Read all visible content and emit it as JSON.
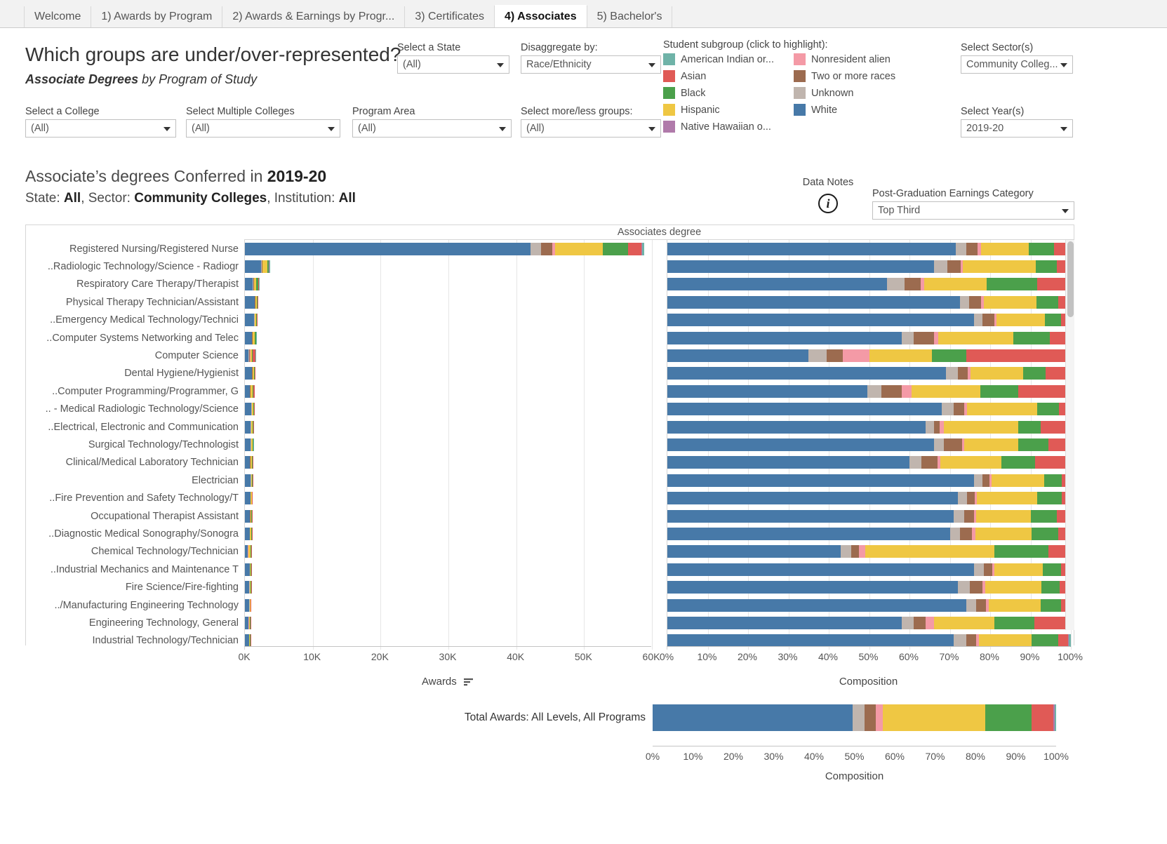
{
  "tabs": [
    {
      "label": "Welcome",
      "active": false
    },
    {
      "label": "1) Awards by Program",
      "active": false
    },
    {
      "label": "2) Awards & Earnings by Progr...",
      "active": false
    },
    {
      "label": "3) Certificates",
      "active": false
    },
    {
      "label": "4) Associates",
      "active": true
    },
    {
      "label": "5) Bachelor's",
      "active": false
    }
  ],
  "header": {
    "question": "Which groups are under/over-represented?",
    "subtitle_bold": "Associate Degrees",
    "subtitle_rest": " by Program of Study"
  },
  "controls": {
    "college": {
      "label": "Select a College",
      "value": "(All)"
    },
    "multi_colleges": {
      "label": "Select Multiple Colleges",
      "value": "(All)"
    },
    "program_area": {
      "label": "Program Area",
      "value": "(All)"
    },
    "state": {
      "label": "Select a State",
      "value": "(All)"
    },
    "disaggregate": {
      "label": "Disaggregate by:",
      "value": "Race/Ethnicity"
    },
    "more_less": {
      "label": "Select more/less groups:",
      "value": "(All)"
    },
    "sector": {
      "label": "Select Sector(s)",
      "value": "Community Colleg..."
    },
    "year": {
      "label": "Select Year(s)",
      "value": "2019-20"
    },
    "earnings": {
      "label": "Post-Graduation Earnings Category",
      "value": "Top Third"
    }
  },
  "legend": {
    "title": "Student subgroup (click to highlight):",
    "col1": [
      {
        "label": "American Indian or...",
        "color": "#6FB3A8"
      },
      {
        "label": "Asian",
        "color": "#E05A56"
      },
      {
        "label": "Black",
        "color": "#4BA04B"
      },
      {
        "label": "Hispanic",
        "color": "#EFC743"
      },
      {
        "label": "Native Hawaiian o...",
        "color": "#B07AAA"
      }
    ],
    "col2": [
      {
        "label": "Nonresident alien",
        "color": "#F49AA6"
      },
      {
        "label": "Two or more races",
        "color": "#9C6B4F"
      },
      {
        "label": "Unknown",
        "color": "#C0B5AE"
      },
      {
        "label": "White",
        "color": "#4779A8"
      }
    ]
  },
  "chart_header": {
    "title_plain": "Associate’s degrees Conferred in ",
    "title_bold": "2019-20",
    "sub_parts": [
      "State: ",
      "All",
      ", Sector: ",
      "Community Colleges",
      ", Institution: ",
      "All"
    ],
    "data_notes_label": "Data Notes",
    "info_icon": "info-icon",
    "band_header": "Associates degree"
  },
  "axes": {
    "awards_ticks": [
      "0K",
      "10K",
      "20K",
      "30K",
      "40K",
      "50K",
      "60K"
    ],
    "awards_caption": "Awards",
    "comp_ticks": [
      "0%",
      "10%",
      "20%",
      "30%",
      "40%",
      "50%",
      "60%",
      "70%",
      "80%",
      "90%",
      "100%"
    ],
    "comp_caption": "Composition",
    "total_caption": "Composition",
    "total_label": "Total Awards: All Levels, All Programs"
  },
  "chart_data": {
    "type": "bar",
    "title": "Associate's degrees Conferred in 2019-20",
    "subtitle": "State: All, Sector: Community Colleges, Institution: All",
    "orientation": "horizontal",
    "stacked": true,
    "series": [
      {
        "name": "White",
        "color": "#4779A8"
      },
      {
        "name": "Unknown",
        "color": "#C0B5AE"
      },
      {
        "name": "Two or more races",
        "color": "#9C6B4F"
      },
      {
        "name": "Nonresident alien",
        "color": "#F49AA6"
      },
      {
        "name": "Hispanic",
        "color": "#EFC743"
      },
      {
        "name": "Black",
        "color": "#4BA04B"
      },
      {
        "name": "Asian",
        "color": "#E05A56"
      },
      {
        "name": "Native Hawaiian o...",
        "color": "#B07AAA"
      },
      {
        "name": "American Indian or...",
        "color": "#6FB3A8"
      }
    ],
    "awards_xlabel": "Awards",
    "awards_xlim": [
      0,
      60000
    ],
    "comp_xlabel": "Composition",
    "comp_xlim": [
      0,
      100
    ],
    "categories": [
      "Registered Nursing/Registered Nurse",
      "Radiologic Technology/Science - Radiogr..",
      "Respiratory Care Therapy/Therapist",
      "Physical Therapy Technician/Assistant",
      "Emergency Medical Technology/Technici..",
      "Computer Systems Networking and Telec..",
      "Computer Science",
      "Dental Hygiene/Hygienist",
      "Computer Programming/Programmer, G..",
      "Medical Radiologic Technology/Science - ..",
      "Electrical, Electronic and Communication..",
      "Surgical Technology/Technologist",
      "Clinical/Medical Laboratory Technician",
      "Electrician",
      "Fire Prevention and Safety Technology/T..",
      "Occupational Therapist Assistant",
      "Diagnostic Medical Sonography/Sonogra..",
      "Chemical Technology/Technician",
      "Industrial Mechanics and Maintenance T..",
      "Fire Science/Fire-fighting",
      "Manufacturing Engineering Technology/..",
      "Engineering Technology, General",
      "Industrial Technology/Technician"
    ],
    "awards_totals": [
      58900,
      3600,
      2100,
      1950,
      1800,
      1700,
      1600,
      1500,
      1450,
      1400,
      1350,
      1300,
      1200,
      1150,
      1100,
      1050,
      1020,
      980,
      950,
      920,
      900,
      880,
      860
    ],
    "composition_pct": [
      [
        71.5,
        2.6,
        2.8,
        0.8,
        11.8,
        6.4,
        3.4,
        0.2,
        0.5
      ],
      [
        66.0,
        3.4,
        3.3,
        0.6,
        18.0,
        5.2,
        2.8,
        0.2,
        0.5
      ],
      [
        54.5,
        4.2,
        4.0,
        1.0,
        15.5,
        12.5,
        7.3,
        0.3,
        0.7
      ],
      [
        72.5,
        2.3,
        3.0,
        0.7,
        13.0,
        5.3,
        2.6,
        0.2,
        0.4
      ],
      [
        76.0,
        2.0,
        3.0,
        0.6,
        12.0,
        4.0,
        1.8,
        0.2,
        0.4
      ],
      [
        58.0,
        3.0,
        5.0,
        1.2,
        18.5,
        9.0,
        4.5,
        0.3,
        0.5
      ],
      [
        35.0,
        4.5,
        4.0,
        6.5,
        15.5,
        8.5,
        25.0,
        0.4,
        0.6
      ],
      [
        69.0,
        3.0,
        2.5,
        0.7,
        13.0,
        5.5,
        5.8,
        0.2,
        0.3
      ],
      [
        49.5,
        3.5,
        5.0,
        2.5,
        17.0,
        9.5,
        12.5,
        0.2,
        0.3
      ],
      [
        68.0,
        3.0,
        2.5,
        0.7,
        17.5,
        5.3,
        2.5,
        0.2,
        0.3
      ],
      [
        64.0,
        2.0,
        1.5,
        1.0,
        18.5,
        5.5,
        7.0,
        0.2,
        0.3
      ],
      [
        66.0,
        2.5,
        4.5,
        0.5,
        13.5,
        7.5,
        5.0,
        0.2,
        0.3
      ],
      [
        60.0,
        3.0,
        4.0,
        0.7,
        15.0,
        8.5,
        8.3,
        0.2,
        0.3
      ],
      [
        76.0,
        2.0,
        1.8,
        0.6,
        13.0,
        4.4,
        1.7,
        0.2,
        0.3
      ],
      [
        72.0,
        2.2,
        2.0,
        0.5,
        15.0,
        6.0,
        1.8,
        0.2,
        0.3
      ],
      [
        71.0,
        2.5,
        2.5,
        0.6,
        13.5,
        6.5,
        3.0,
        0.2,
        0.2
      ],
      [
        70.0,
        2.5,
        3.0,
        0.8,
        14.0,
        6.5,
        2.8,
        0.2,
        0.2
      ],
      [
        43.0,
        2.5,
        2.0,
        1.5,
        32.0,
        13.5,
        5.0,
        0.2,
        0.3
      ],
      [
        76.0,
        2.5,
        2.0,
        0.5,
        12.0,
        4.5,
        2.0,
        0.2,
        0.3
      ],
      [
        72.0,
        3.0,
        3.0,
        0.7,
        14.0,
        4.5,
        2.3,
        0.2,
        0.3
      ],
      [
        74.0,
        2.5,
        2.5,
        0.6,
        13.0,
        5.0,
        2.0,
        0.2,
        0.2
      ],
      [
        58.0,
        3.0,
        3.0,
        2.0,
        15.0,
        10.0,
        8.5,
        0.2,
        0.3
      ],
      [
        71.0,
        3.0,
        2.5,
        0.8,
        13.0,
        6.5,
        2.5,
        0.2,
        0.5
      ]
    ],
    "total_row": {
      "label": "Total Awards: All Levels, All Programs",
      "composition_pct": [
        49.5,
        3.0,
        2.8,
        1.7,
        25.5,
        11.5,
        5.3,
        0.3,
        0.4
      ]
    }
  }
}
